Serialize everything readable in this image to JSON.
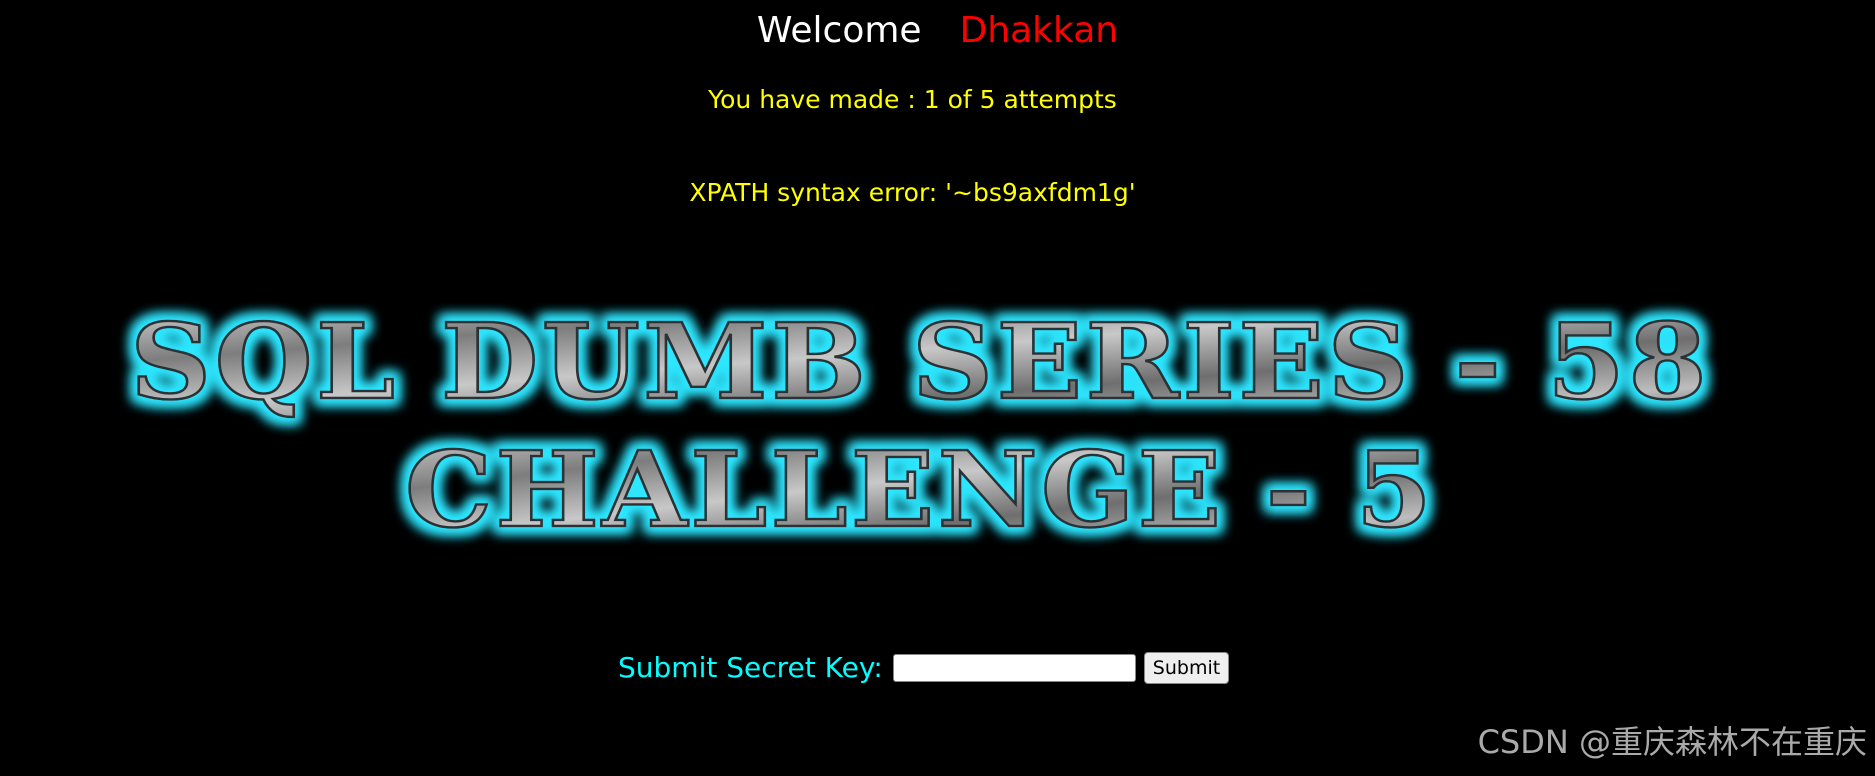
{
  "header": {
    "welcome": "Welcome",
    "username": "Dhakkan"
  },
  "status": {
    "attempts": "You have made : 1 of 5 attempts",
    "error": "XPATH syntax error: '~bs9axfdm1g'"
  },
  "banner": {
    "line1": "SQL DUMB SERIES - 58",
    "line2": "CHALLENGE - 5",
    "glow_color": "#2ee6ff"
  },
  "form": {
    "label": "Submit Secret Key:",
    "input_value": "",
    "submit_label": "Submit"
  },
  "watermark": "CSDN @重庆森林不在重庆",
  "colors": {
    "background": "#000000",
    "welcome": "#ffffff",
    "username": "#ff0000",
    "status": "#ffff00",
    "form_label": "#00ffff"
  }
}
